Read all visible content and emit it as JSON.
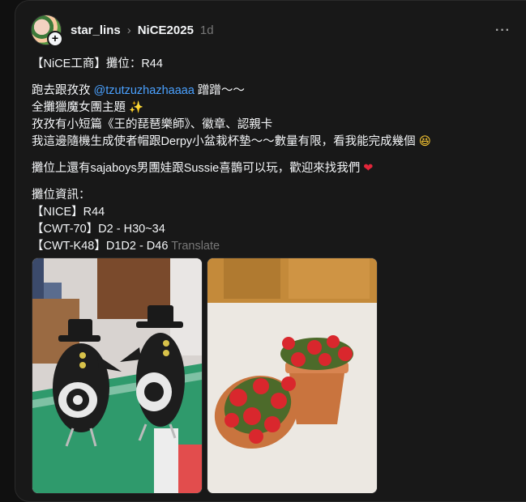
{
  "post": {
    "username": "star_lins",
    "community": "NiCE2025",
    "time": "1d",
    "more_label": "···",
    "lines": {
      "l1": "【NiCE工商】攤位：R44",
      "l2_pre": "跑去跟孜孜 ",
      "l2_mention": "@tzutzuzhazhaaaa",
      "l2_post": " 蹭蹭～～",
      "l3": "全攤獵魔女團主題",
      "l4": "孜孜有小短篇《王的琵琶樂師》、徽章、認親卡",
      "l5": "我這邊隨機生成使者帽跟Derpy小盆栽杯墊～～數量有限，看我能完成幾個",
      "l6": "攤位上還有sajaboys男團娃跟Sussie喜鵲可以玩，歡迎來找我們",
      "l7": "攤位資訊：",
      "l8": "【NICE】R44",
      "l9": "【CWT-70】D2 - H30~34",
      "l10": "【CWT-K48】D1D2 - D46"
    },
    "translate_label": "Translate",
    "icons": {
      "sparkle": "✨",
      "emoji": "😆",
      "heart": "❤"
    }
  }
}
